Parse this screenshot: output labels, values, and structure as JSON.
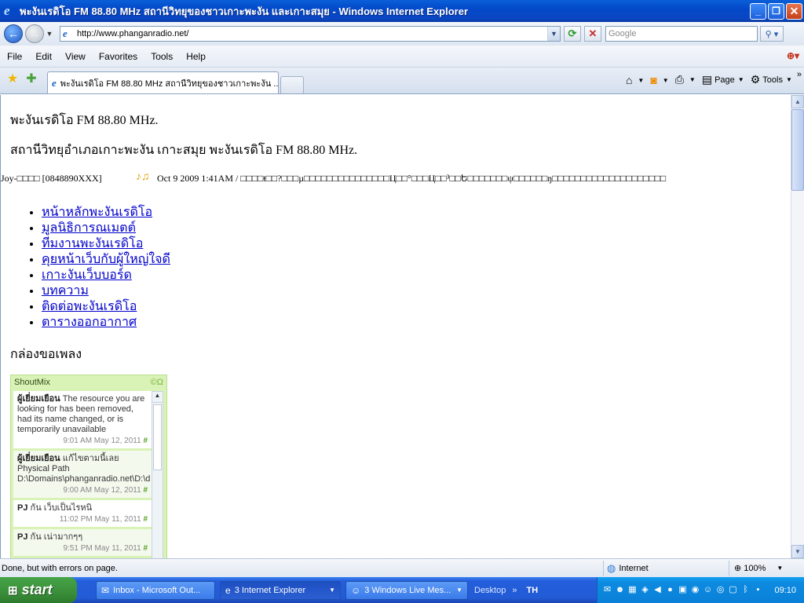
{
  "window": {
    "title": "พะงันเรดิโอ FM 88.80 MHz สถานีวิทยุของชาวเกาะพะงัน และเกาะสมุย - Windows Internet Explorer",
    "app_icon": "ie-icon"
  },
  "address_bar": {
    "url": "http://www.phanganradio.net/",
    "search_placeholder": "Google"
  },
  "menu": {
    "items": [
      "File",
      "Edit",
      "View",
      "Favorites",
      "Tools",
      "Help"
    ]
  },
  "tabs": {
    "active_label": "พะงันเรดิโอ FM 88.80 MHz สถานีวิทยุของชาวเกาะพะงัน ..."
  },
  "command_bar": {
    "page_label": "Page",
    "tools_label": "Tools"
  },
  "page": {
    "site_name": "พะงันเรดิโอ FM 88.80 MHz.",
    "site_description": "สถานีวิทยุอำเภอเกาะพะงัน เกาะสมุย พะงันเรดิโอ FM 88.80 MHz.",
    "marquee": {
      "user": "Joy-□□□□ [0848890XXX]",
      "message": "Oct 9 2009 1:41AM / □□□□ŧ□□?□□□µ□□□□□□□□□□□□□□□Ц□□°□□□Ц□□³□□Ե□□□□□□□ψ□□□□□□ŋ□□□□□□□□□□□□□□□□□□□□"
    },
    "nav_links": [
      "หน้าหลักพะงันเรดิโอ",
      "มูลนิธิการณเมตต์",
      "ทีมงานพะงันเรดิโอ",
      "คุยหน้าเว็บกับผู้ใหญ่ใจดี",
      "เกาะงันเว็บบอร์ด",
      "บทความ",
      "ติดต่อพะงันเรดิโอ",
      "ตารางออกอากาศ"
    ],
    "song_box_title": "กล่องขอเพลง"
  },
  "shoutmix": {
    "title": "ShoutMix",
    "entries": [
      {
        "name": "ผู้เยี่ยมเยือน",
        "text": "The resource you are looking for has been removed, had its name changed, or is temporarily unavailable",
        "time": "9:01 AM May 12, 2011"
      },
      {
        "name": "ผู้เยี่ยมเยือน",
        "text": "แก้ไขตามนี้เลย Physical Path D:\\Domains\\phanganradio.net\\D:\\d",
        "time": "9:00 AM May 12, 2011"
      },
      {
        "name": "PJ",
        "text": "กัน เว็บเป็นไรหนิ",
        "time": "11:02 PM May 11, 2011"
      },
      {
        "name": "PJ",
        "text": "กัน เน่ามากๆๆ",
        "time": "9:51 PM May 11, 2011"
      }
    ]
  },
  "status_bar": {
    "text": "Done, but with errors on page.",
    "zone": "Internet",
    "zoom": "100%"
  },
  "taskbar": {
    "start_label": "start",
    "tasks": [
      {
        "label": "Inbox - Microsoft Out...",
        "icon": "outlook-icon"
      },
      {
        "label": "3 Internet Explorer",
        "icon": "ie-icon"
      },
      {
        "label": "3 Windows Live Mes...",
        "icon": "messenger-icon"
      }
    ],
    "desktop_label": "Desktop",
    "language": "TH",
    "clock": "09:10"
  },
  "colors": {
    "titlebar": "#0349c9",
    "link": "#0000cc",
    "shoutmix_bg": "#d9f3b6",
    "taskbar": "#245edb",
    "start_button": "#3a8f3a"
  }
}
